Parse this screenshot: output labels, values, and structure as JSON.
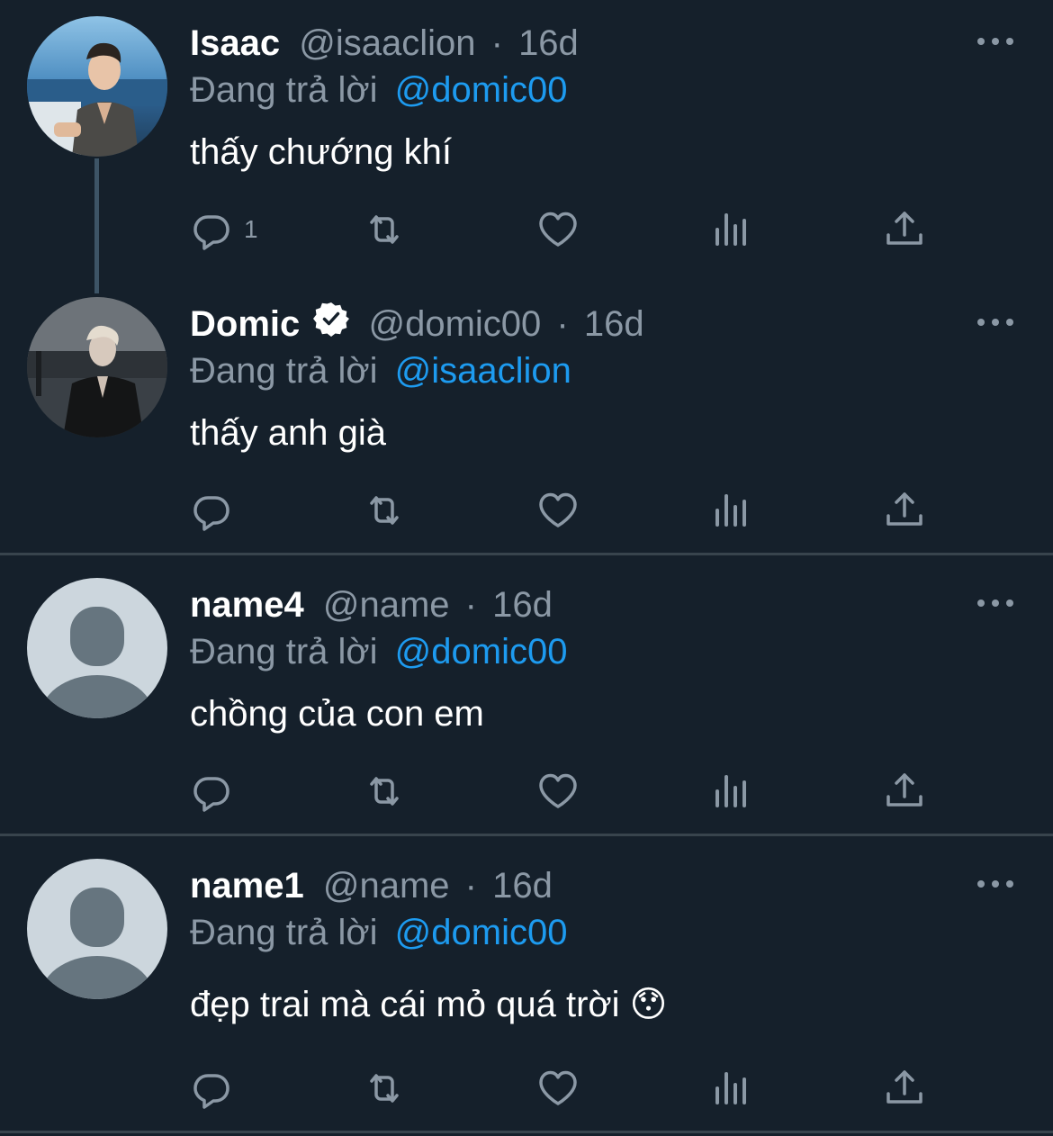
{
  "tweets": [
    {
      "name": "Isaac",
      "handle": "@isaaclion",
      "dot": "·",
      "time": "16d",
      "replying_prefix": "Đang trả lời",
      "replying_to": "@domic00",
      "text": "thấy chướng khí",
      "reply_count": "1",
      "avatar": "photo"
    },
    {
      "name": "Domic",
      "verified": true,
      "handle": "@domic00",
      "dot": "·",
      "time": "16d",
      "replying_prefix": "Đang trả lời",
      "replying_to": "@isaaclion",
      "text": "thấy anh già",
      "reply_count": "",
      "avatar": "photo"
    },
    {
      "name": "name4",
      "handle": "@name",
      "dot": "·",
      "time": "16d",
      "replying_prefix": "Đang trả lời",
      "replying_to": "@domic00",
      "text": "chồng của con em",
      "reply_count": "",
      "avatar": "default"
    },
    {
      "name": "name1",
      "handle": "@name",
      "dot": "·",
      "time": "16d",
      "replying_prefix": "Đang trả lời",
      "replying_to": "@domic00",
      "text": "đẹp trai mà cái mỏ quá trời 😯",
      "reply_count": "",
      "avatar": "default"
    }
  ],
  "icons": [
    "reply-icon",
    "retweet-icon",
    "like-icon",
    "views-icon",
    "share-icon",
    "more-icon",
    "verified-icon"
  ],
  "colors": {
    "background": "#15202b",
    "text": "#ffffff",
    "muted": "#8b98a5",
    "link": "#1d9bf0",
    "divider": "#38444d"
  }
}
